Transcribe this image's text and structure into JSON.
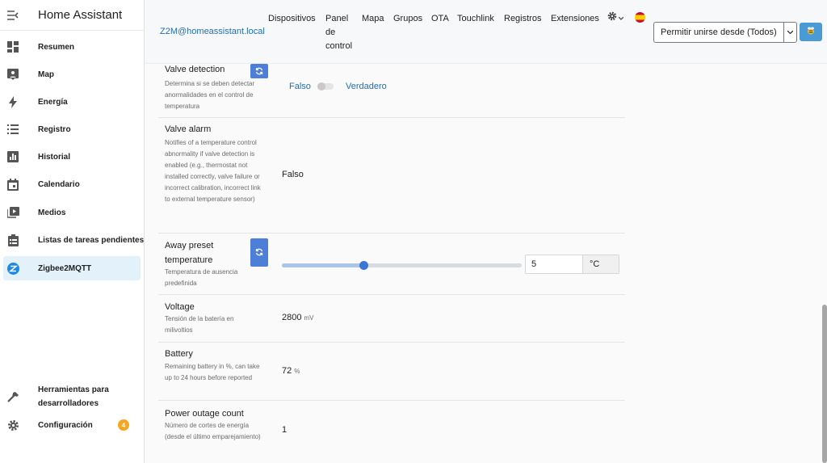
{
  "sidebar": {
    "title": "Home Assistant",
    "items": [
      {
        "label": "Resumen",
        "icon": "dashboard-icon"
      },
      {
        "label": "Map",
        "icon": "map-icon"
      },
      {
        "label": "Energía",
        "icon": "lightning-bolt-icon"
      },
      {
        "label": "Registro",
        "icon": "format-list-icon"
      },
      {
        "label": "Historial",
        "icon": "chart-box-icon"
      },
      {
        "label": "Calendario",
        "icon": "calendar-icon"
      },
      {
        "label": "Medios",
        "icon": "play-box-icon"
      },
      {
        "label": "Listas de tareas pendientes",
        "icon": "clipboard-list-icon"
      },
      {
        "label": "Zigbee2MQTT",
        "icon": "zigbee-icon"
      }
    ],
    "bottom": [
      {
        "label": "Herramientas para desarrolladores",
        "icon": "hammer-icon"
      },
      {
        "label": "Configuración",
        "icon": "cog-icon",
        "badge": "4"
      }
    ]
  },
  "topbar": {
    "device_link": "Z2M@homeassistant.local",
    "nav": [
      "Dispositivos",
      "Panel de control",
      "Mapa",
      "Grupos",
      "OTA",
      "Touchlink",
      "Registros",
      "Extensiones"
    ],
    "permit_join": "Permitir unirse desde (Todos)"
  },
  "rows": {
    "valve_detection": {
      "title": "Valve detection",
      "desc": "Determina si se deben detectar anormalidades en el control de temperatura",
      "false_label": "Falso",
      "true_label": "Verdadero"
    },
    "valve_alarm": {
      "title": "Valve alarm",
      "desc": "Notifies of a temperature control abnormality if valve detection is enabled (e.g., thermostat not installed correctly, valve failure or incorrect calibration, incorrect link to external temperature sensor)",
      "value": "Falso"
    },
    "away_preset": {
      "title": "Away preset temperature",
      "desc": "Temperatura de ausencia predefinida",
      "value": "5",
      "unit": "°C",
      "slider_fraction": 0.34
    },
    "voltage": {
      "title": "Voltage",
      "desc": "Tensión de la batería en milivoltios",
      "value": "2800",
      "unit": "mV"
    },
    "battery": {
      "title": "Battery",
      "desc": "Remaining battery in %, can take up to 24 hours before reported",
      "value": "72",
      "unit": "%"
    },
    "power_outage": {
      "title": "Power outage count",
      "desc": "Número de cortes de energía (desde el último emparejamiento)",
      "value": "1"
    }
  },
  "colors": {
    "accent": "#1e88e5",
    "link": "#1f6fb2",
    "refresh_button": "#4e7fd8",
    "badge": "#f5a623"
  }
}
